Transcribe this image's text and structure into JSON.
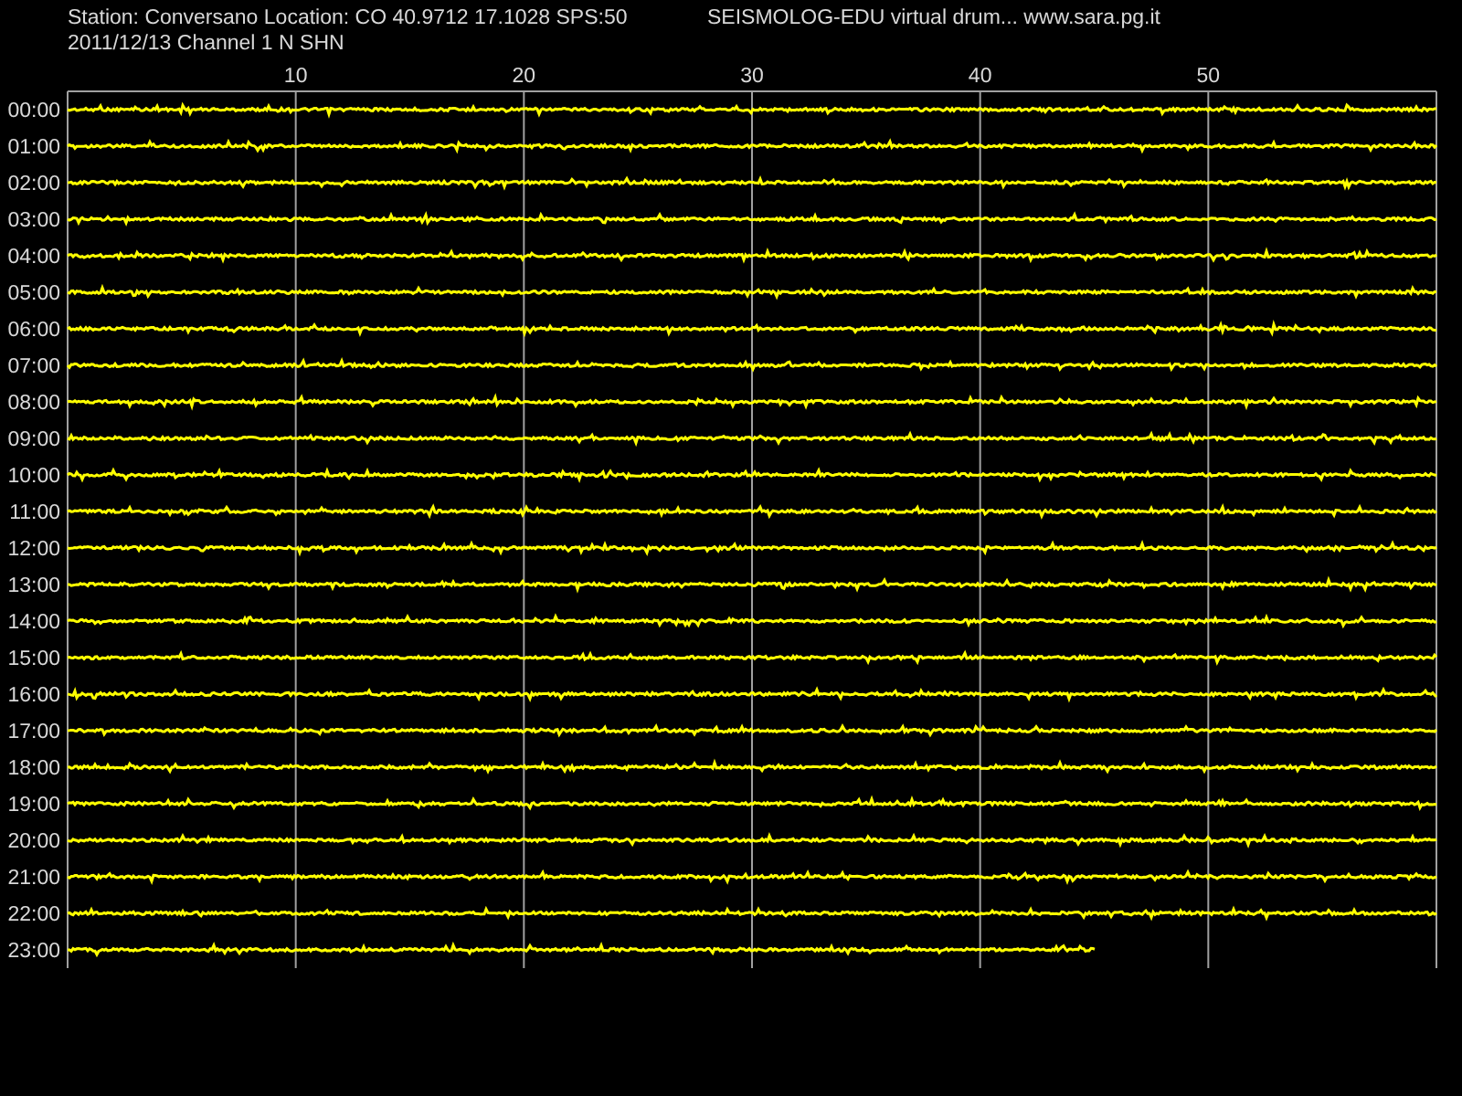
{
  "header": {
    "station": "Station: Conversano Location: CO 40.9712 17.1028 SPS:50",
    "title": "SEISMOLOG-EDU virtual drum... www.sara.pg.it",
    "date_channel": "2011/12/13  Channel 1 N SHN"
  },
  "minute_ticks": [
    "10",
    "20",
    "30",
    "40",
    "50"
  ],
  "rows": [
    {
      "label": "00:00",
      "level": 1
    },
    {
      "label": "01:00",
      "level": 1
    },
    {
      "label": "02:00",
      "level": 1
    },
    {
      "label": "03:00",
      "level": 1
    },
    {
      "label": "04:00",
      "level": 1
    },
    {
      "label": "05:00",
      "level": 1
    },
    {
      "label": "06:00",
      "level": 1
    },
    {
      "label": "07:00",
      "level": 1
    },
    {
      "label": "08:00",
      "level": 1
    },
    {
      "label": "09:00",
      "level": 1
    },
    {
      "label": "10:00",
      "level": 1
    },
    {
      "label": "11:00",
      "level": 1
    },
    {
      "label": "12:00",
      "level": 1
    },
    {
      "label": "13:00",
      "level": 1
    },
    {
      "label": "14:00",
      "level": 1
    },
    {
      "label": "15:00",
      "level": 1
    },
    {
      "label": "16:00",
      "level": 1
    },
    {
      "label": "17:00",
      "level": 1
    },
    {
      "label": "18:00",
      "level": 1
    },
    {
      "label": "19:00",
      "level": 1
    },
    {
      "label": "20:00",
      "level": 1
    },
    {
      "label": "21:00",
      "level": 1
    },
    {
      "label": "22:00",
      "level": 1
    },
    {
      "label": "23:00",
      "level": 0.75
    }
  ]
}
